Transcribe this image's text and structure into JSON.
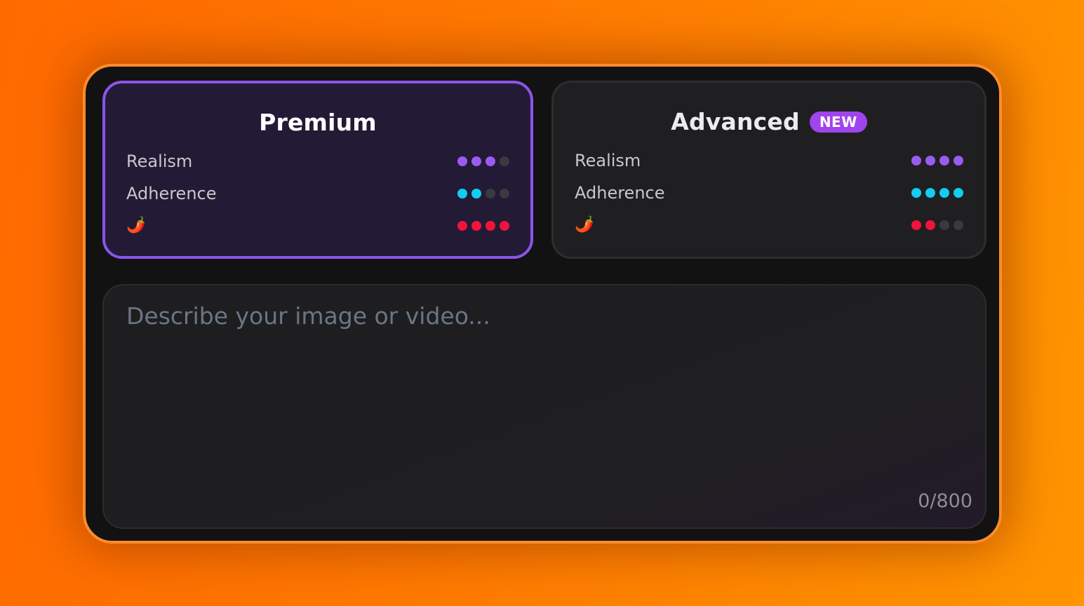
{
  "colors": {
    "background_orange": "#ff7a00",
    "frame_border": "#ff8c2a",
    "selected_border": "#8b55ea",
    "badge": "#a044ee",
    "realism_dot": "#9a5cf0",
    "adherence_dot": "#12cdf0",
    "spice_dot": "#f0143c",
    "inactive_dot": "#3a3a3e"
  },
  "models": [
    {
      "name": "Premium",
      "selected": true,
      "badge": "",
      "ratings": [
        {
          "label": "Realism",
          "icon": "chili-pepper-icon",
          "value": 3,
          "max": 4,
          "color": "#9a5cf0"
        },
        {
          "label": "Adherence",
          "value": 2,
          "max": 4,
          "color": "#12cdf0"
        },
        {
          "label": "",
          "icon": "chili-pepper-icon",
          "value": 4,
          "max": 4,
          "color": "#f0143c"
        }
      ]
    },
    {
      "name": "Advanced",
      "selected": false,
      "badge": "NEW",
      "ratings": [
        {
          "label": "Realism",
          "value": 4,
          "max": 4,
          "color": "#9a5cf0"
        },
        {
          "label": "Adherence",
          "value": 4,
          "max": 4,
          "color": "#12cdf0"
        },
        {
          "label": "",
          "icon": "chili-pepper-icon",
          "value": 2,
          "max": 4,
          "color": "#f0143c"
        }
      ]
    }
  ],
  "prompt": {
    "placeholder": "Describe your image or video...",
    "value": "",
    "counter": "0/800"
  }
}
